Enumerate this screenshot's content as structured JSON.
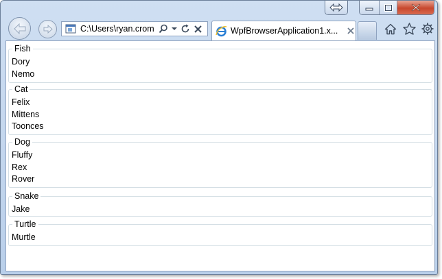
{
  "browser": {
    "address_text": "C:\\Users\\ryan.crom",
    "tab_title": "WpfBrowserApplication1.x...",
    "icons": {
      "back": "back-arrow-icon",
      "forward": "forward-arrow-icon",
      "page": "page-icon",
      "search": "search-icon",
      "dropdown": "chevron-down-icon",
      "refresh": "refresh-icon",
      "stop": "close-icon",
      "ie": "internet-explorer-icon",
      "tab_close": "close-icon",
      "home": "home-icon",
      "favorites": "star-icon",
      "tools": "gear-icon",
      "compat": "resize-arrows-icon",
      "minimize": "minimize-icon",
      "maximize": "maximize-icon",
      "window_close": "close-icon"
    }
  },
  "groups": [
    {
      "header": "Fish",
      "items": [
        "Dory",
        "Nemo"
      ]
    },
    {
      "header": "Cat",
      "items": [
        "Felix",
        "Mittens",
        "Toonces"
      ]
    },
    {
      "header": "Dog",
      "items": [
        "Fluffy",
        "Rex",
        "Rover"
      ]
    },
    {
      "header": "Snake",
      "items": [
        "Jake"
      ]
    },
    {
      "header": "Turtle",
      "items": [
        "Murtle"
      ]
    }
  ]
}
